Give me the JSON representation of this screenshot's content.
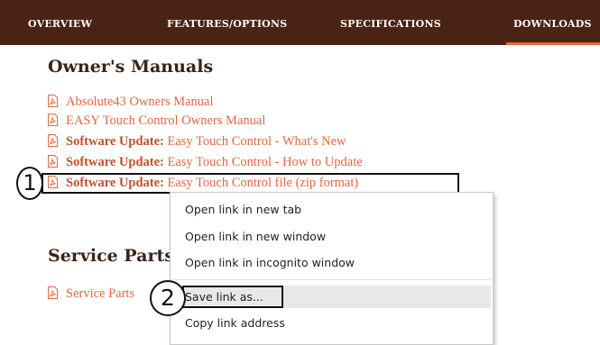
{
  "nav": {
    "tabs": [
      {
        "label": "OVERVIEW",
        "active": false
      },
      {
        "label": "FEATURES/OPTIONS",
        "active": false
      },
      {
        "label": "SPECIFICATIONS",
        "active": false
      },
      {
        "label": "DOWNLOADS",
        "active": true
      }
    ]
  },
  "manuals": {
    "title": "Owner's Manuals",
    "links": [
      {
        "bold": "",
        "text": "Absolute43 Owners Manual"
      },
      {
        "bold": "",
        "text": "EASY Touch Control Owners Manual"
      },
      {
        "bold": "Software Update:",
        "text": " Easy Touch Control - What's New"
      },
      {
        "bold": "Software Update:",
        "text": " Easy Touch Control - How to Update"
      },
      {
        "bold": "Software Update:",
        "text": " Easy Touch Control file (zip format)"
      }
    ]
  },
  "service": {
    "title": "Service Parts",
    "links": [
      {
        "text": "Service Parts"
      }
    ]
  },
  "context_menu": {
    "items": [
      "Open link in new tab",
      "Open link in new window",
      "Open link in incognito window",
      "Save link as...",
      "Copy link address"
    ],
    "highlighted_index": 3
  },
  "annotations": {
    "step1": "1",
    "step2": "2"
  },
  "colors": {
    "nav_bg": "#4a2314",
    "accent": "#e2673f",
    "link": "#e2673f",
    "heading": "#3a2418"
  }
}
